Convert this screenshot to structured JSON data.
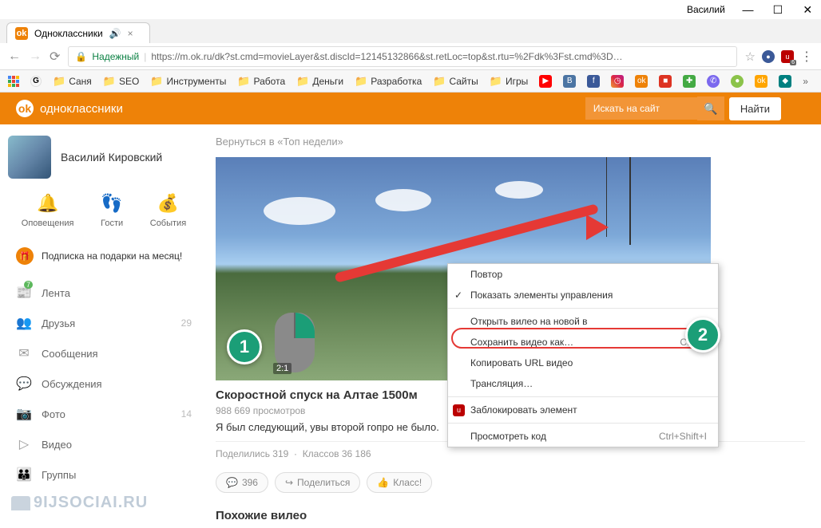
{
  "window": {
    "user": "Василий"
  },
  "tab": {
    "title": "Одноклассники"
  },
  "url": {
    "secure_label": "Надежный",
    "text": "https://m.ok.ru/dk?st.cmd=movieLayer&st.discId=12145132866&st.retLoc=top&st.rtu=%2Fdk%3Fst.cmd%3D…",
    "ext_badge": "6"
  },
  "bookmarks": [
    "Саня",
    "SEO",
    "Инструменты",
    "Работа",
    "Деньги",
    "Разработка",
    "Сайты",
    "Игры"
  ],
  "ok": {
    "brand": "одноклассники",
    "search_placeholder": "Искать на сайт",
    "find": "Найти"
  },
  "user": {
    "name": "Василий Кировский"
  },
  "quick": {
    "notifications": "Оповещения",
    "guests": "Гости",
    "events": "События"
  },
  "promo": "Подписка на подарки на месяц!",
  "nav": {
    "feed": "Лента",
    "feed_badge": "7",
    "friends": "Друзья",
    "friends_count": "29",
    "messages": "Сообщения",
    "discussions": "Обсуждения",
    "photos": "Фото",
    "photos_count": "14",
    "video": "Видео",
    "groups": "Группы"
  },
  "content": {
    "back": "Вернуться в «Топ недели»",
    "title": "Скоростной спуск на Алтае 1500м",
    "views": "988 669 просмотров",
    "desc": "Я был следующий, увы второй гопро не было.",
    "shares": "Поделились 319",
    "likes_line": "Классов 36 186",
    "comments": "396",
    "share_btn": "Поделиться",
    "class_btn": "Класс!",
    "similar": "Похожие вилео",
    "time": "2:1"
  },
  "ctx": {
    "repeat": "Повтор",
    "show_controls": "Показать элементы управления",
    "open_new": "Открыть вилео на новой в",
    "save_as": "Сохранить видео как…",
    "copy_url": "Копировать URL видео",
    "broadcast": "Трансляция…",
    "block": "Заблокировать элемент",
    "inspect": "Просмотреть код",
    "ctrl_s": "Ctrl+S",
    "ctrl_shift_i": "Ctrl+Shift+I"
  },
  "markers": {
    "one": "1",
    "two": "2"
  },
  "watermark": "9IJSOCIAI.RU"
}
